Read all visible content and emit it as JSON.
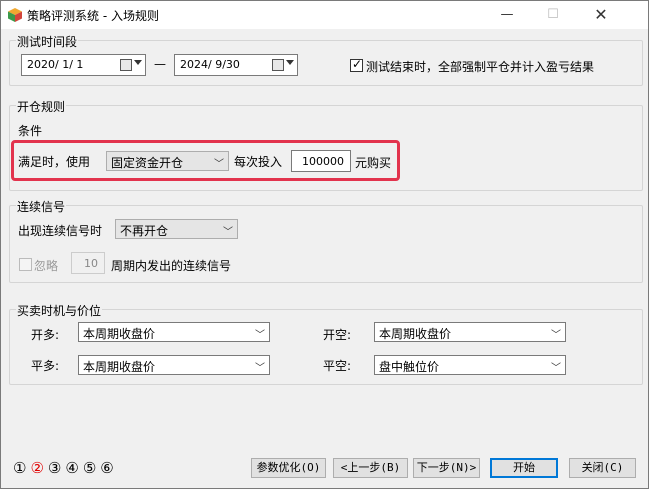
{
  "window": {
    "title": "策略评测系统 - 入场规则",
    "minimize_label": "—",
    "maximize_label": "☐",
    "close_label": "✕"
  },
  "test_period": {
    "group_label": "测试时间段",
    "start_date": "2020/ 1/ 1",
    "separator": "—",
    "end_date": "2024/ 9/30",
    "force_close_checked": true,
    "force_close_label": "测试结束时，全部强制平仓并计入盈亏结果"
  },
  "open_rules": {
    "group_label": "开仓规则",
    "condition_label": "条件",
    "when_met_label": "满足时，使用",
    "mode_value": "固定资金开仓",
    "each_invest_label": "每次投入",
    "amount_value": "100000",
    "buy_unit_label": "元购买"
  },
  "consecutive": {
    "group_label": "连续信号",
    "occurs_label": "出现连续信号时",
    "occurs_value": "不再开仓",
    "ignore_label": "忽略",
    "ignore_checked": false,
    "period_value": "10",
    "period_label": "周期内发出的连续信号"
  },
  "timing": {
    "group_label": "买卖时机与价位",
    "open_long_label": "开多:",
    "open_long_value": "本周期收盘价",
    "open_short_label": "开空:",
    "open_short_value": "本周期收盘价",
    "close_long_label": "平多:",
    "close_long_value": "本周期收盘价",
    "close_short_label": "平空:",
    "close_short_value": "盘中触位价"
  },
  "steps": [
    "①",
    "②",
    "③",
    "④",
    "⑤",
    "⑥"
  ],
  "buttons": {
    "optimize": "参数优化(O)",
    "prev": "<上一步(B)",
    "next": "下一步(N)>",
    "start": "开始",
    "close": "关闭(C)"
  },
  "colors": {
    "highlight": "#e2334d",
    "active_step": "#e00000"
  }
}
